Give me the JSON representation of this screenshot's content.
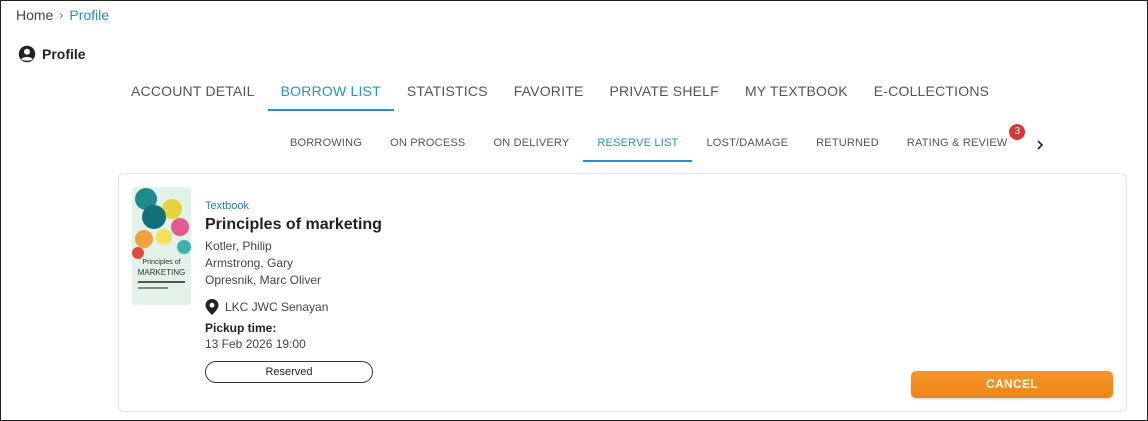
{
  "breadcrumb": {
    "home": "Home",
    "separator": "›",
    "current": "Profile"
  },
  "page_title": "Profile",
  "main_tabs": [
    {
      "label": "ACCOUNT DETAIL",
      "active": false
    },
    {
      "label": "BORROW LIST",
      "active": true
    },
    {
      "label": "STATISTICS",
      "active": false
    },
    {
      "label": "FAVORITE",
      "active": false
    },
    {
      "label": "PRIVATE SHELF",
      "active": false
    },
    {
      "label": "MY TEXTBOOK",
      "active": false
    },
    {
      "label": "E-COLLECTIONS",
      "active": false
    }
  ],
  "sub_tabs": [
    {
      "label": "BORROWING",
      "active": false
    },
    {
      "label": "ON PROCESS",
      "active": false
    },
    {
      "label": "ON DELIVERY",
      "active": false
    },
    {
      "label": "RESERVE LIST",
      "active": true
    },
    {
      "label": "LOST/DAMAGE",
      "active": false
    },
    {
      "label": "RETURNED",
      "active": false
    },
    {
      "label": "RATING & REVIEW",
      "active": false,
      "badge": "3"
    }
  ],
  "item": {
    "type": "Textbook",
    "title": "Principles of marketing",
    "authors": [
      "Kotler, Philip",
      "Armstrong, Gary",
      "Opresnik, Marc Oliver"
    ],
    "cover_text_1": "Principles of",
    "cover_text_2": "MARKETING",
    "location": "LKC JWC Senayan",
    "pickup_label": "Pickup time:",
    "pickup_value": "13 Feb 2026 19:00",
    "status": "Reserved",
    "cancel_label": "CANCEL"
  },
  "colors": {
    "accent": "#2a8fc4",
    "cancel": "#f08a1c",
    "badge": "#d23a3a"
  }
}
